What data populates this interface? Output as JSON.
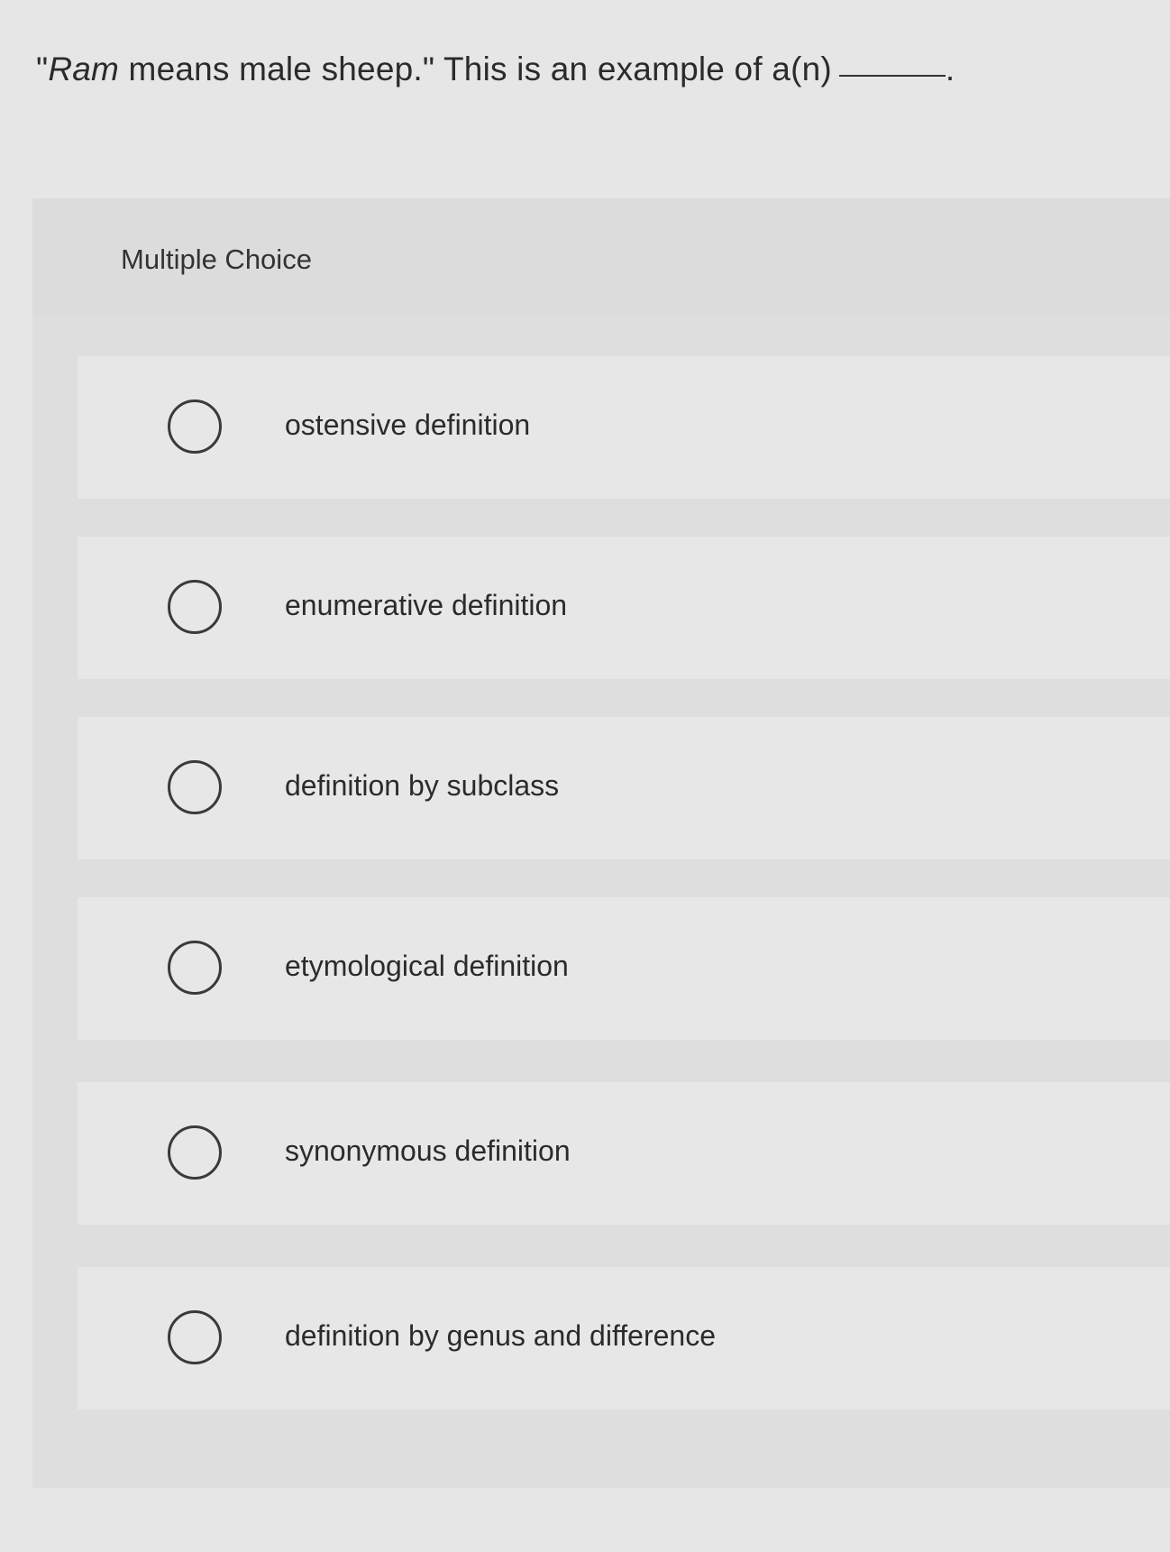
{
  "question": {
    "quote_open": "\"",
    "term": "Ram",
    "rest": " means male sheep.\" This is an example of a(n)",
    "end_punct": "."
  },
  "section": {
    "label": "Multiple Choice"
  },
  "options": [
    {
      "label": "ostensive definition"
    },
    {
      "label": "enumerative definition"
    },
    {
      "label": "definition by subclass"
    },
    {
      "label": "etymological definition"
    },
    {
      "label": "synonymous definition"
    },
    {
      "label": "definition by genus and difference"
    }
  ]
}
